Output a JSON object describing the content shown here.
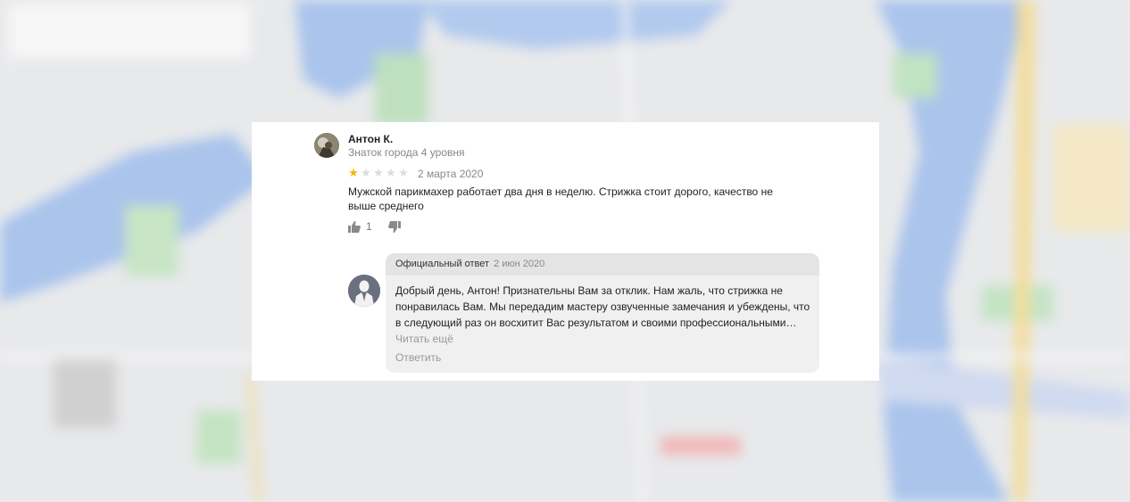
{
  "review": {
    "author_name": "Антон К.",
    "author_level": "Знаток города 4 уровня",
    "rating": 1,
    "rating_max": 5,
    "date": "2 марта 2020",
    "text": "Мужской парикмахер работает два дня в неделю. Стрижка стоит дорого, качество не выше среднего",
    "likes": "1",
    "star_color": "#f5b700"
  },
  "reply": {
    "label": "Официальный ответ",
    "date": "2 июн 2020",
    "text": "Добрый день, Антон! Признательны Вам за отклик. Нам жаль, что стрижка не понравилась Вам. Мы передадим мастеру озвученные замечания и убеждены, что в следующий раз он восхитит Вас результатом и своими профессиональными…",
    "read_more": "Читать ещё",
    "action": "Ответить"
  },
  "icons": {
    "like": "thumbs-up-icon",
    "dislike": "thumbs-down-icon",
    "star": "star-icon"
  }
}
